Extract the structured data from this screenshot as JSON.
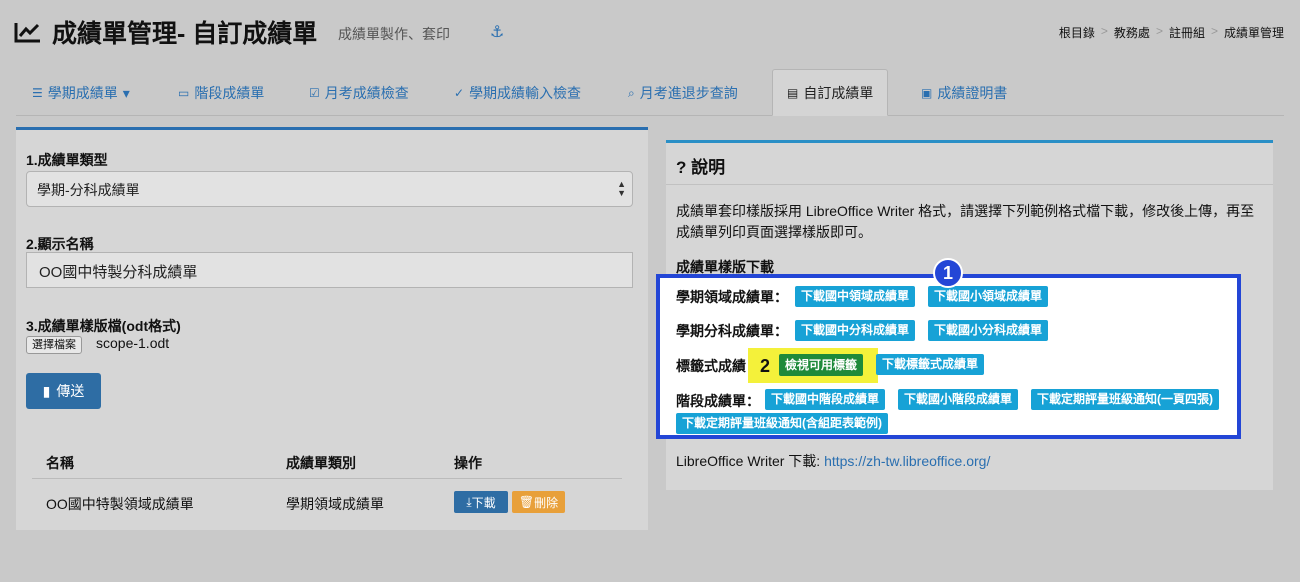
{
  "header": {
    "title": "成績單管理- 自訂成績單",
    "subtitle": "成績單製作、套印",
    "anchor_icon": "anchor-icon",
    "breadcrumb": [
      "根目錄",
      "教務處",
      "註冊組",
      "成績單管理"
    ]
  },
  "tabs": [
    {
      "label": "學期成績單",
      "icon": "list-icon",
      "caret": "▾"
    },
    {
      "label": "階段成績單",
      "icon": "card-icon"
    },
    {
      "label": "月考成績檢查",
      "icon": "check-square-icon"
    },
    {
      "label": "學期成績輸入檢查",
      "icon": "check-circle-icon"
    },
    {
      "label": "月考進退步查詢",
      "icon": "search-icon"
    },
    {
      "label": "自訂成績單",
      "icon": "id-card-icon",
      "active": true
    },
    {
      "label": "成績證明書",
      "icon": "contact-icon"
    }
  ],
  "form": {
    "type_label": "1.成績單類型",
    "type_value": "學期-分科成績單",
    "name_label": "2.顯示名稱",
    "name_value": "OO國中特製分科成績單",
    "template_label": "3.成績單樣版檔(odt格式)",
    "file_button": "選擇檔案",
    "file_name": "scope-1.odt",
    "submit_label": "傳送"
  },
  "table": {
    "headers": [
      "名稱",
      "成績單類別",
      "操作"
    ],
    "rows": [
      {
        "name": "OO國中特製領域成績單",
        "category": "學期領域成績單",
        "download": "下載",
        "delete": "刪除"
      }
    ]
  },
  "help": {
    "title": "說明",
    "description": "成績單套印樣版採用 LibreOffice Writer 格式，請選擇下列範例格式檔下載，修改後上傳，再至成績單列印頁面選擇樣版即可。",
    "section_title": "成績單樣版下載",
    "rows": [
      {
        "label": "學期領域成績單：",
        "buttons": [
          "下載國中領域成績單",
          "下載國小領域成績單"
        ]
      },
      {
        "label": "學期分科成績單：",
        "buttons": [
          "下載國中分科成績單",
          "下載國小分科成績單"
        ]
      },
      {
        "label": "標籤式成績",
        "buttons": [
          "檢視可用標籤",
          "下載標籤式成績單"
        ]
      },
      {
        "label": "階段成績單：",
        "buttons": [
          "下載國中階段成績單",
          "下載國小階段成績單",
          "下載定期評量班級通知(一頁四張)",
          "下載定期評量班級通知(含組距表範例)"
        ]
      }
    ],
    "writer_label": "LibreOffice Writer 下載:",
    "writer_url": "https://zh-tw.libreoffice.org/"
  },
  "annotations": {
    "badge1": "1",
    "badge2": "2"
  },
  "colors": {
    "accent": "#2a6fb0",
    "highlight_border": "#2346d6",
    "teal_button": "#17a2d6",
    "green_button": "#1e8a3a",
    "highlight_yellow": "#f4f13a"
  }
}
